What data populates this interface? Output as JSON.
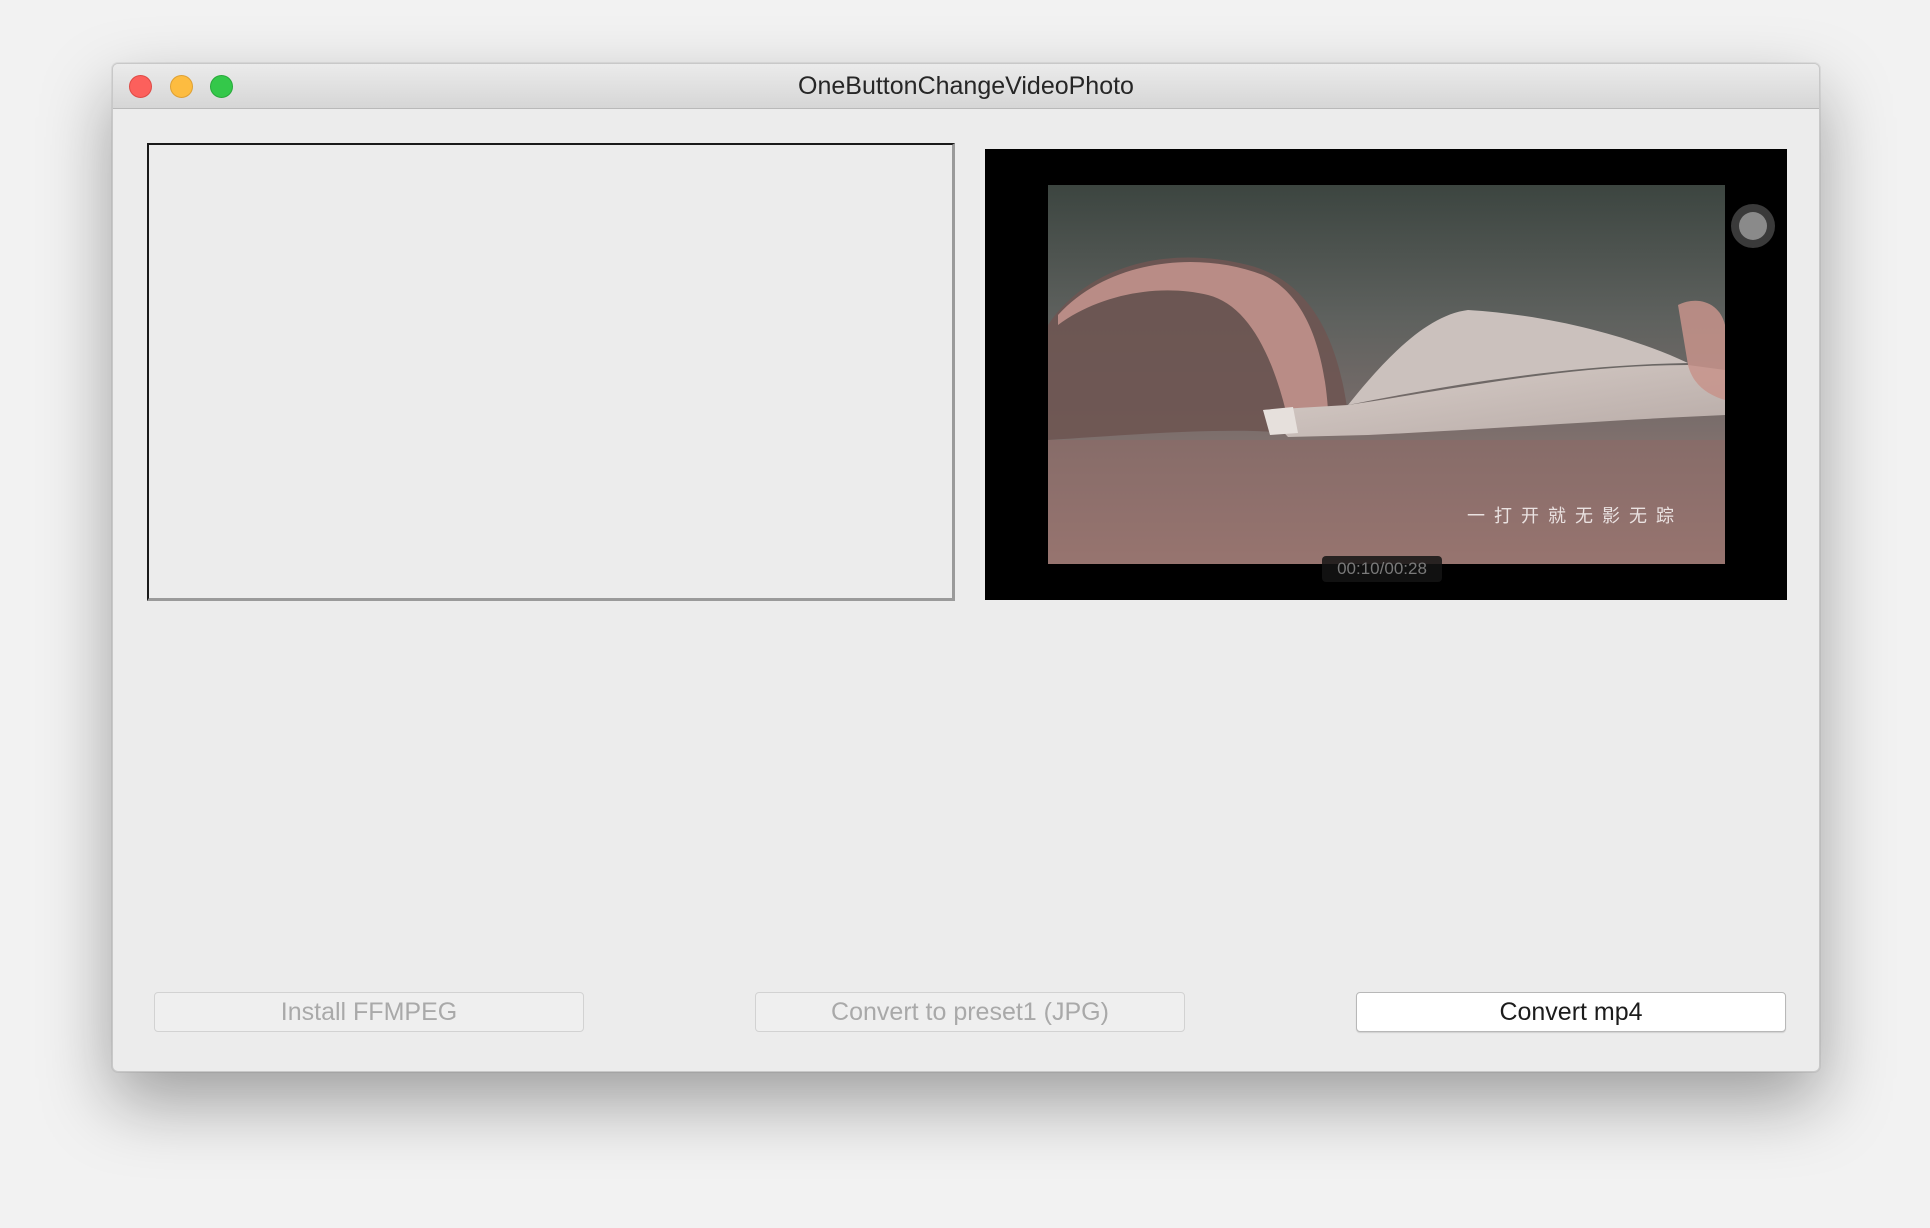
{
  "window": {
    "title": "OneButtonChangeVideoPhoto"
  },
  "video": {
    "subtitle": "一打开就无影无踪",
    "timecode": "00:10/00:28"
  },
  "buttons": {
    "install_ffmpeg": "Install FFMPEG",
    "convert_preset1": "Convert to preset1 (JPG)",
    "convert_mp4": "Convert mp4"
  },
  "icons": {
    "close": "close-icon",
    "minimize": "minimize-icon",
    "maximize": "maximize-icon",
    "record": "record-dot-icon"
  },
  "colors": {
    "close": "#fc605c",
    "minimize": "#fdbc40",
    "maximize": "#34c84a"
  }
}
